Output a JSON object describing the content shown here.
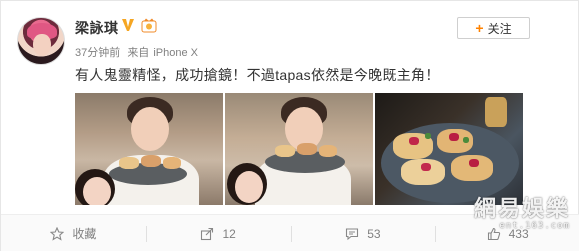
{
  "post": {
    "author": "梁詠琪",
    "time": "37分钟前",
    "source_prefix": "来自",
    "source": "iPhone X",
    "text": "有人鬼靈精怪，成功搶鏡！不過tapas依然是今晚既主角！",
    "images": [
      "photo-selfie-with-plate",
      "photo-selfie-with-plate-2",
      "photo-tapas-closeup"
    ]
  },
  "follow_button": {
    "label": "关注",
    "icon": "plus-icon"
  },
  "actions": [
    {
      "label": "收藏",
      "icon": "star-icon"
    },
    {
      "label": "12",
      "icon": "share-icon"
    },
    {
      "label": "53",
      "icon": "comment-icon"
    },
    {
      "label": "433",
      "icon": "like-icon"
    }
  ],
  "badges": {
    "verified": "V",
    "verified_icon": "verified-badge-icon",
    "level_icon": "level-badge-icon"
  },
  "watermark": {
    "line1": "網易娛樂",
    "line2": "ent.163.com"
  },
  "colors": {
    "accent": "#ff8200",
    "verified": "#f5a623",
    "text": "#333333",
    "meta": "#808080"
  }
}
